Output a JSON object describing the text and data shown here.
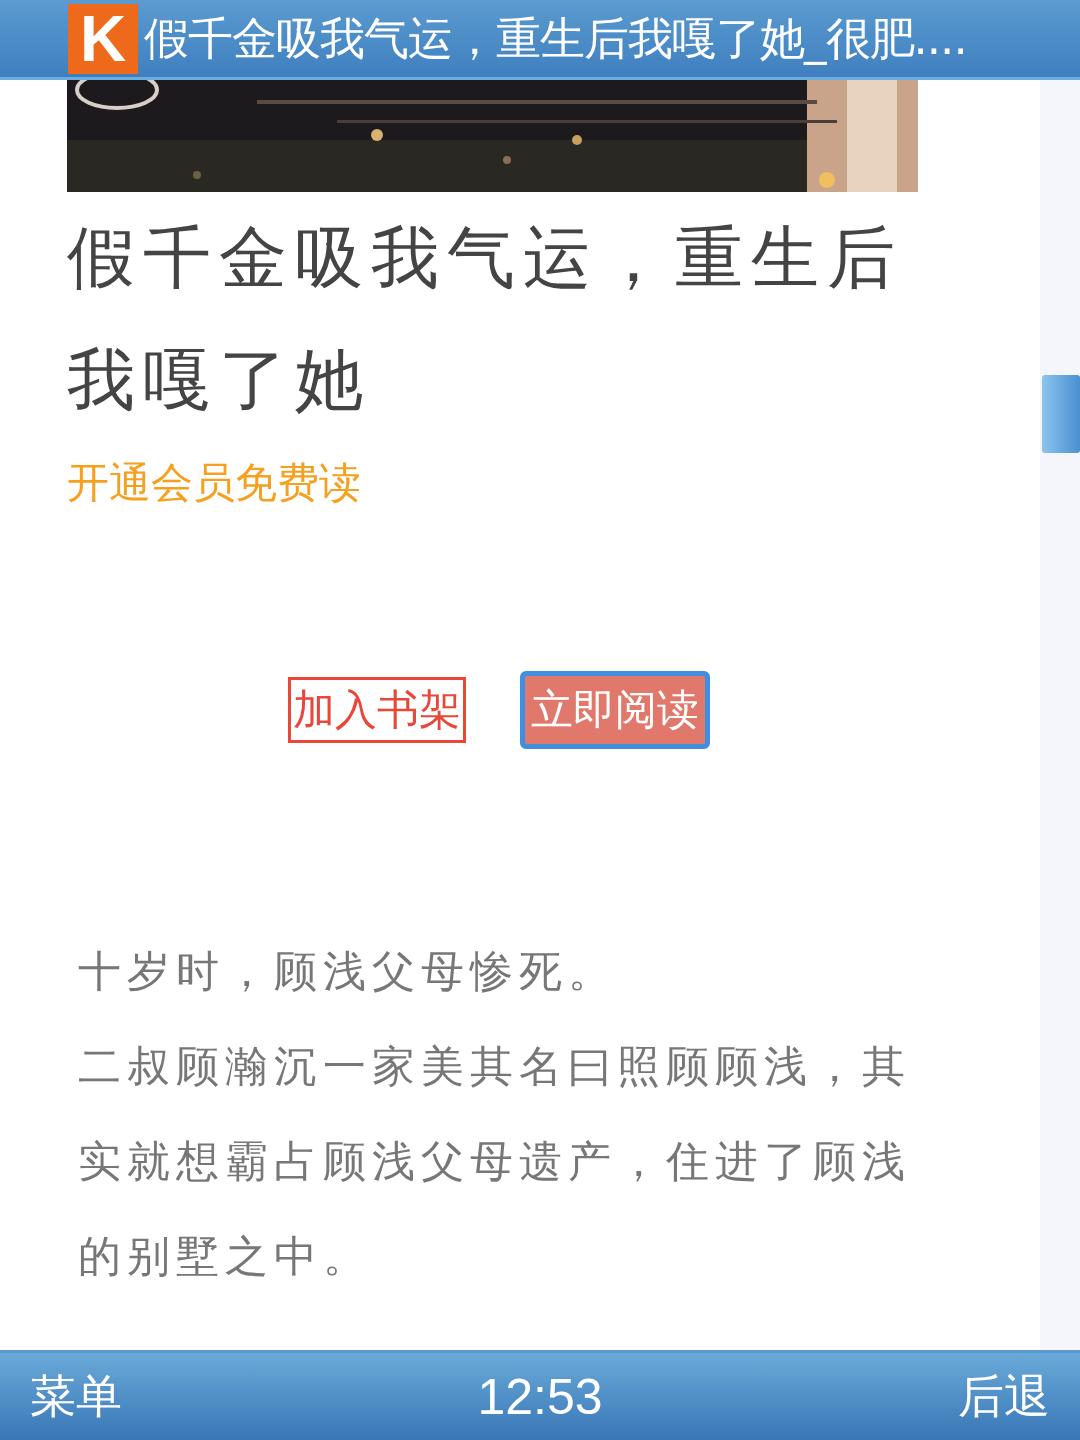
{
  "title_bar": {
    "logo": "K",
    "title": "假千金吸我气运，重生后我嘎了她_很肥...."
  },
  "book": {
    "title": "假千金吸我气运，重生后我嘎了她",
    "member_link": "开通会员免费读"
  },
  "buttons": [
    {
      "label": "加入书架",
      "kind": "outline",
      "selected": false
    },
    {
      "label": "立即阅读",
      "kind": "filled",
      "selected": true
    }
  ],
  "paragraphs": [
    "十岁时，顾浅父母惨死。",
    "二叔顾瀚沉一家美其名曰照顾顾浅，其实就想霸占顾浅父母遗产，住进了顾浅的别墅之中。"
  ],
  "soft_keys": {
    "left": "菜单",
    "clock": "12:53",
    "right": "后退"
  }
}
